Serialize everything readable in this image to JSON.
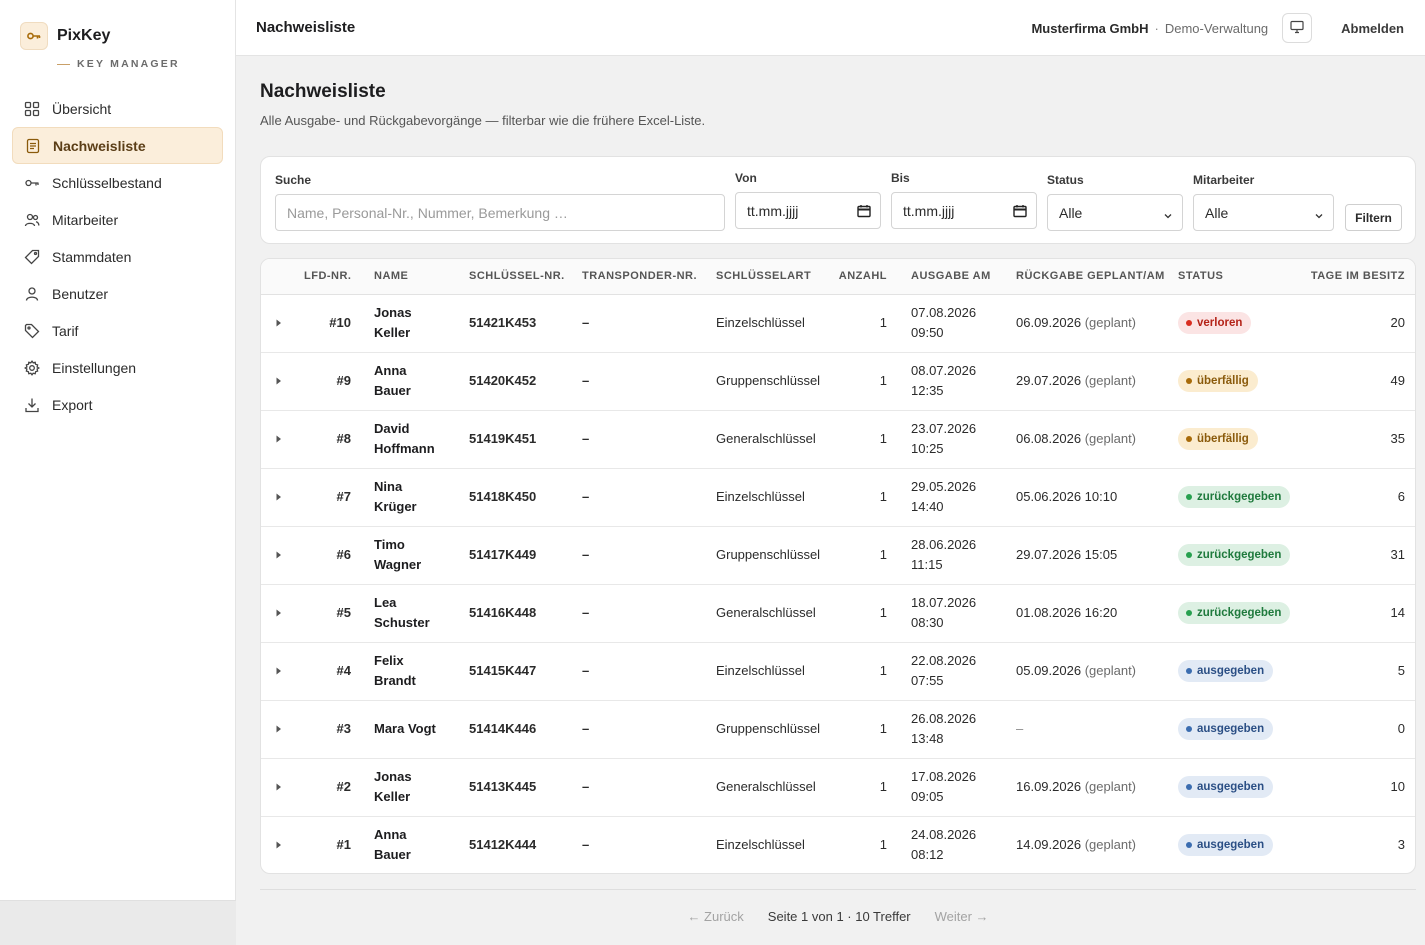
{
  "brand": {
    "name": "PixKey",
    "subtitle": "KEY MANAGER"
  },
  "sidebar": {
    "items": [
      {
        "label": "Übersicht",
        "icon": "grid-icon"
      },
      {
        "label": "Nachweisliste",
        "icon": "document-icon",
        "active": true
      },
      {
        "label": "Schlüsselbestand",
        "icon": "key-icon"
      },
      {
        "label": "Mitarbeiter",
        "icon": "users-icon"
      },
      {
        "label": "Stammdaten",
        "icon": "tag-icon"
      },
      {
        "label": "Benutzer",
        "icon": "user-icon"
      },
      {
        "label": "Tarif",
        "icon": "price-tag-icon"
      },
      {
        "label": "Einstellungen",
        "icon": "gear-icon"
      },
      {
        "label": "Export",
        "icon": "download-icon"
      }
    ]
  },
  "header": {
    "title": "Nachweisliste",
    "company": "Musterfirma GmbH",
    "separator": "·",
    "org": "Demo-Verwaltung",
    "logout": "Abmelden"
  },
  "main": {
    "title": "Nachweisliste",
    "subtitle": "Alle Ausgabe- und Rückgabevorgänge — filterbar wie die frühere Excel-Liste."
  },
  "filters": {
    "search_label": "Suche",
    "search_placeholder": "Name, Personal-Nr., Nummer, Bemerkung …",
    "from_label": "Von",
    "from_placeholder": "tt.mm.jjjj",
    "to_label": "Bis",
    "to_placeholder": "tt.mm.jjjj",
    "status_label": "Status",
    "status_value": "Alle",
    "employee_label": "Mitarbeiter",
    "employee_value": "Alle",
    "filter_button": "Filtern"
  },
  "table": {
    "columns": [
      "LFD-NR.",
      "NAME",
      "SCHLÜSSEL-NR.",
      "TRANSPONDER-NR.",
      "SCHLÜSSELART",
      "ANZAHL",
      "AUSGABE AM",
      "RÜCKGABE GEPLANT/AM",
      "STATUS",
      "TAGE IM BESITZ"
    ],
    "rows": [
      {
        "nr": "#10",
        "first": "Jonas",
        "last": "Keller",
        "key": "51421K453",
        "transponder": "–",
        "type": "Einzelschlüssel",
        "count": "1",
        "issue_date": "07.08.2026",
        "issue_time": "09:50",
        "return_date": "06.09.2026",
        "return_note": "(geplant)",
        "status": "verloren",
        "status_class": "b-verloren",
        "days": "20"
      },
      {
        "nr": "#9",
        "first": "Anna",
        "last": "Bauer",
        "key": "51420K452",
        "transponder": "–",
        "type": "Gruppenschlüssel",
        "count": "1",
        "issue_date": "08.07.2026",
        "issue_time": "12:35",
        "return_date": "29.07.2026",
        "return_note": "(geplant)",
        "status": "überfällig",
        "status_class": "b-ueberfaellig",
        "days": "49"
      },
      {
        "nr": "#8",
        "first": "David",
        "last": "Hoffmann",
        "key": "51419K451",
        "transponder": "–",
        "type": "Generalschlüssel",
        "count": "1",
        "issue_date": "23.07.2026",
        "issue_time": "10:25",
        "return_date": "06.08.2026",
        "return_note": "(geplant)",
        "status": "überfällig",
        "status_class": "b-ueberfaellig",
        "days": "35"
      },
      {
        "nr": "#7",
        "first": "Nina",
        "last": "Krüger",
        "key": "51418K450",
        "transponder": "–",
        "type": "Einzelschlüssel",
        "count": "1",
        "issue_date": "29.05.2026",
        "issue_time": "14:40",
        "return_date": "05.06.2026 10:10",
        "return_note": "",
        "status": "zurückgegeben",
        "status_class": "b-zurueck",
        "days": "6"
      },
      {
        "nr": "#6",
        "first": "Timo",
        "last": "Wagner",
        "key": "51417K449",
        "transponder": "–",
        "type": "Gruppenschlüssel",
        "count": "1",
        "issue_date": "28.06.2026",
        "issue_time": "11:15",
        "return_date": "29.07.2026 15:05",
        "return_note": "",
        "status": "zurückgegeben",
        "status_class": "b-zurueck",
        "days": "31"
      },
      {
        "nr": "#5",
        "first": "Lea",
        "last": "Schuster",
        "key": "51416K448",
        "transponder": "–",
        "type": "Generalschlüssel",
        "count": "1",
        "issue_date": "18.07.2026",
        "issue_time": "08:30",
        "return_date": "01.08.2026 16:20",
        "return_note": "",
        "status": "zurückgegeben",
        "status_class": "b-zurueck",
        "days": "14"
      },
      {
        "nr": "#4",
        "first": "Felix",
        "last": "Brandt",
        "key": "51415K447",
        "transponder": "–",
        "type": "Einzelschlüssel",
        "count": "1",
        "issue_date": "22.08.2026",
        "issue_time": "07:55",
        "return_date": "05.09.2026",
        "return_note": "(geplant)",
        "status": "ausgegeben",
        "status_class": "b-ausgegeben",
        "days": "5"
      },
      {
        "nr": "#3",
        "first": "Mara Vogt",
        "last": "",
        "key": "51414K446",
        "transponder": "–",
        "type": "Gruppenschlüssel",
        "count": "1",
        "issue_date": "26.08.2026",
        "issue_time": "13:48",
        "return_date": "–",
        "return_note": "",
        "status": "ausgegeben",
        "status_class": "b-ausgegeben",
        "days": "0"
      },
      {
        "nr": "#2",
        "first": "Jonas",
        "last": "Keller",
        "key": "51413K445",
        "transponder": "–",
        "type": "Generalschlüssel",
        "count": "1",
        "issue_date": "17.08.2026",
        "issue_time": "09:05",
        "return_date": "16.09.2026",
        "return_note": "(geplant)",
        "status": "ausgegeben",
        "status_class": "b-ausgegeben",
        "days": "10"
      },
      {
        "nr": "#1",
        "first": "Anna",
        "last": "Bauer",
        "key": "51412K444",
        "transponder": "–",
        "type": "Einzelschlüssel",
        "count": "1",
        "issue_date": "24.08.2026",
        "issue_time": "08:12",
        "return_date": "14.09.2026",
        "return_note": "(geplant)",
        "status": "ausgegeben",
        "status_class": "b-ausgegeben",
        "days": "3"
      }
    ]
  },
  "pagination": {
    "prev": "← Zurück",
    "info": "Seite 1 von 1 · 10 Treffer",
    "next": "Weiter →"
  },
  "colors": {
    "accent_bg": "#fbeedb",
    "accent_text": "#5b3e17",
    "status_lost": "#d92d20",
    "status_overdue": "#a86b09",
    "status_returned": "#27a04f",
    "status_issued": "#3b6db0"
  }
}
